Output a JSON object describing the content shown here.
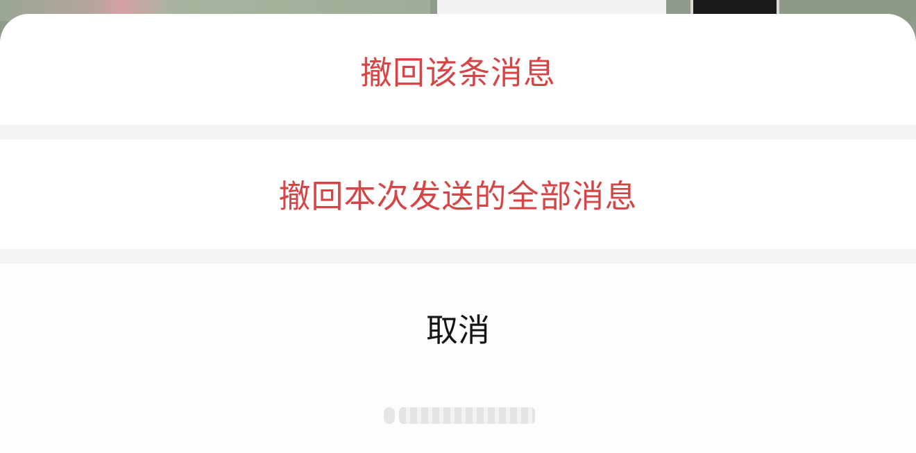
{
  "action_sheet": {
    "options": [
      {
        "label": "撤回该条消息",
        "color": "#d64545"
      },
      {
        "label": "撤回本次发送的全部消息",
        "color": "#d64545"
      }
    ],
    "cancel_label": "取消"
  },
  "colors": {
    "destructive": "#d64545",
    "sheet_background": "#ffffff",
    "separator": "#f4f4f4",
    "cancel_text": "#151515"
  }
}
